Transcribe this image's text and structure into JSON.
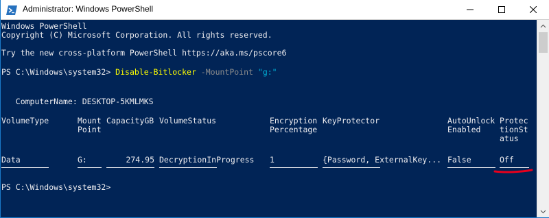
{
  "window": {
    "title": "Administrator: Windows PowerShell",
    "icon": "powershell-icon",
    "controls": [
      "minimize-icon",
      "maximize-icon",
      "close-icon"
    ]
  },
  "console": {
    "banner_line1": "Windows PowerShell",
    "banner_line2": "Copyright (C) Microsoft Corporation. All rights reserved.",
    "banner_line3": "Try the new cross-platform PowerShell https://aka.ms/pscore6",
    "prompt1": "PS C:\\Windows\\system32> ",
    "command": "Disable-Bitlocker",
    "parameter": " -MountPoint ",
    "argument": "\"g:\"",
    "computer_name": "   ComputerName: DESKTOP-5KMLMKS",
    "headers": {
      "volume_type": "VolumeType",
      "mount_point": "Mount\nPoint",
      "capacity": "CapacityGB",
      "volume_status": "VolumeStatus",
      "encryption_percentage": "Encryption\nPercentage",
      "key_protector": "KeyProtector",
      "auto_unlock": "AutoUnlock\nEnabled",
      "protection_status": "Protec\ntionSt\natus"
    },
    "row": {
      "volume_type": "Data",
      "mount_point": "G:",
      "capacity": "274.95",
      "volume_status": "DecryptionInProgress",
      "encryption_percentage": "1",
      "key_protector": "{Password, ExternalKey...",
      "auto_unlock": "False",
      "protection_status": "Off"
    },
    "prompt2": "PS C:\\Windows\\system32>"
  },
  "colors": {
    "background": "#012456",
    "text": "#eeedf0",
    "command": "#ffff00",
    "parameter": "#8c8c8c",
    "string": "#00b2d8",
    "annotation": "#e8001c"
  }
}
